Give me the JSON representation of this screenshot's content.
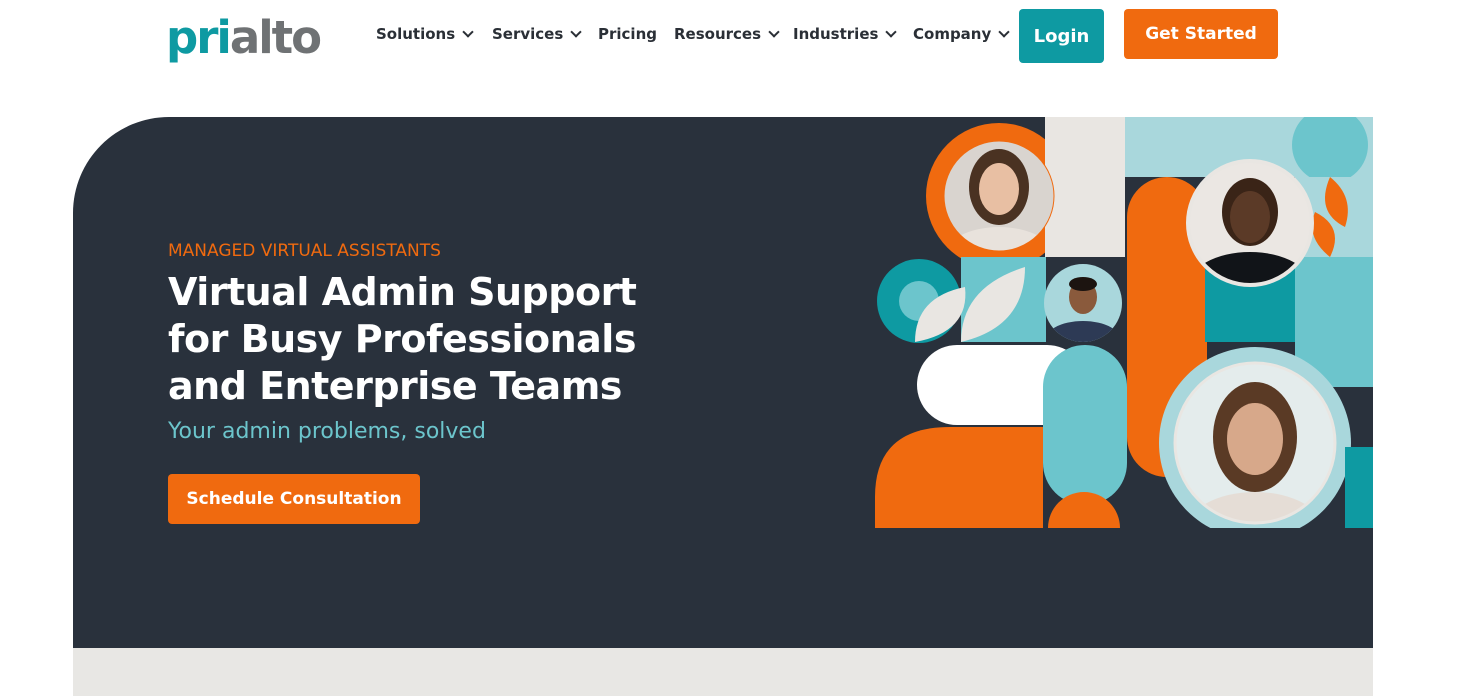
{
  "header": {
    "logo": {
      "part1": "pri",
      "part2": "alto"
    },
    "nav": [
      {
        "label": "Solutions",
        "dropdown": true
      },
      {
        "label": "Services",
        "dropdown": true
      },
      {
        "label": "Pricing",
        "dropdown": false
      },
      {
        "label": "Resources",
        "dropdown": true
      },
      {
        "label": "Industries",
        "dropdown": true
      },
      {
        "label": "Company",
        "dropdown": true
      }
    ],
    "login_label": "Login",
    "get_started_label": "Get Started"
  },
  "hero": {
    "eyebrow": "MANAGED VIRTUAL ASSISTANTS",
    "headline": [
      "Virtual Admin Support",
      "for Busy Professionals",
      "and Enterprise Teams"
    ],
    "subtitle": "Your admin problems, solved",
    "cta_label": "Schedule Consultation"
  },
  "colors": {
    "teal": "#0e9aa2",
    "light_teal": "#6cc5cc",
    "pale_teal": "#a9d7dc",
    "orange": "#f06a0f",
    "navy": "#29313c",
    "cream": "#e9e6e2",
    "logo_gray": "#6f7274"
  }
}
